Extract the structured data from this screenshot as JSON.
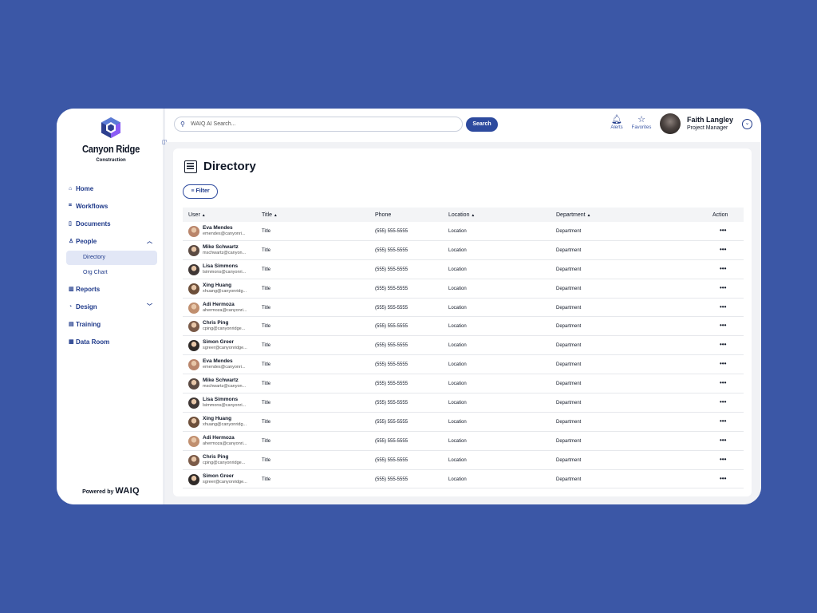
{
  "brand": {
    "name": "Canyon Ridge",
    "subtitle": "Construction",
    "powered_by": "Powered by",
    "powered_brand": "WAIQ"
  },
  "sidebar": {
    "items": [
      {
        "label": "Home",
        "icon": "home-icon"
      },
      {
        "label": "Workflows",
        "icon": "grid-icon"
      },
      {
        "label": "Documents",
        "icon": "document-icon"
      },
      {
        "label": "People",
        "icon": "person-icon",
        "expanded": true
      },
      {
        "label": "Reports",
        "icon": "chart-icon"
      },
      {
        "label": "Design",
        "icon": "palette-icon"
      },
      {
        "label": "Training",
        "icon": "book-icon"
      },
      {
        "label": "Data Room",
        "icon": "database-icon"
      }
    ],
    "people_sub": [
      {
        "label": "Directory",
        "active": true
      },
      {
        "label": "Org Chart",
        "active": false
      }
    ]
  },
  "header": {
    "search_placeholder": "WAIQ AI Search...",
    "search_button": "Search",
    "alerts_label": "Alerts",
    "favorites_label": "Favorites",
    "user_name": "Faith Langley",
    "user_role": "Project Manager"
  },
  "page": {
    "title": "Directory",
    "filter_label": "Filter"
  },
  "table": {
    "columns": [
      "User",
      "Title",
      "Phone",
      "Location",
      "Department",
      "Action"
    ],
    "sort_arrow": "▲",
    "rows": [
      {
        "name": "Eva Mendes",
        "email": "emendes@canyonri...",
        "title": "Title",
        "phone": "(555) 555-5555",
        "location": "Location",
        "department": "Department",
        "action": "•••"
      },
      {
        "name": "Mike Schwartz",
        "email": "mschwartz@canyon...",
        "title": "Title",
        "phone": "(555) 555-5555",
        "location": "Location",
        "department": "Department",
        "action": "•••"
      },
      {
        "name": "Lisa Simmons",
        "email": "lsimmons@canyonri...",
        "title": "Title",
        "phone": "(555) 555-5555",
        "location": "Location",
        "department": "Department",
        "action": "•••"
      },
      {
        "name": "Xing Huang",
        "email": "xhuang@canyonridg...",
        "title": "Title",
        "phone": "(555) 555-5555",
        "location": "Location",
        "department": "Department",
        "action": "•••"
      },
      {
        "name": "Adi Hermoza",
        "email": "ahermoza@canyonri...",
        "title": "Title",
        "phone": "(555) 555-5555",
        "location": "Location",
        "department": "Department",
        "action": "•••"
      },
      {
        "name": "Chris Ping",
        "email": "cping@canyonridge...",
        "title": "Title",
        "phone": "(555) 555-5555",
        "location": "Location",
        "department": "Department",
        "action": "•••"
      },
      {
        "name": "Simon Greer",
        "email": "sgreer@canyonridge...",
        "title": "Title",
        "phone": "(555) 555-5555",
        "location": "Location",
        "department": "Department",
        "action": "•••"
      },
      {
        "name": "Eva Mendes",
        "email": "emendes@canyonri...",
        "title": "Title",
        "phone": "(555) 555-5555",
        "location": "Location",
        "department": "Department",
        "action": "•••"
      },
      {
        "name": "Mike Schwartz",
        "email": "mschwartz@canyon...",
        "title": "Title",
        "phone": "(555) 555-5555",
        "location": "Location",
        "department": "Department",
        "action": "•••"
      },
      {
        "name": "Lisa Simmons",
        "email": "lsimmons@canyonri...",
        "title": "Title",
        "phone": "(555) 555-5555",
        "location": "Location",
        "department": "Department",
        "action": "•••"
      },
      {
        "name": "Xing Huang",
        "email": "xhuang@canyonridg...",
        "title": "Title",
        "phone": "(555) 555-5555",
        "location": "Location",
        "department": "Department",
        "action": "•••"
      },
      {
        "name": "Adi Hermoza",
        "email": "ahermoza@canyonri...",
        "title": "Title",
        "phone": "(555) 555-5555",
        "location": "Location",
        "department": "Department",
        "action": "•••"
      },
      {
        "name": "Chris Ping",
        "email": "cping@canyonridge...",
        "title": "Title",
        "phone": "(555) 555-5555",
        "location": "Location",
        "department": "Department",
        "action": "•••"
      },
      {
        "name": "Simon Greer",
        "email": "sgreer@canyonridge...",
        "title": "Title",
        "phone": "(555) 555-5555",
        "location": "Location",
        "department": "Department",
        "action": "•••"
      }
    ]
  },
  "colors": {
    "background": "#3b57a6",
    "accent": "#2d4a9e",
    "nav_text": "#1f3a8a",
    "active_bg": "#e2e7f6"
  }
}
